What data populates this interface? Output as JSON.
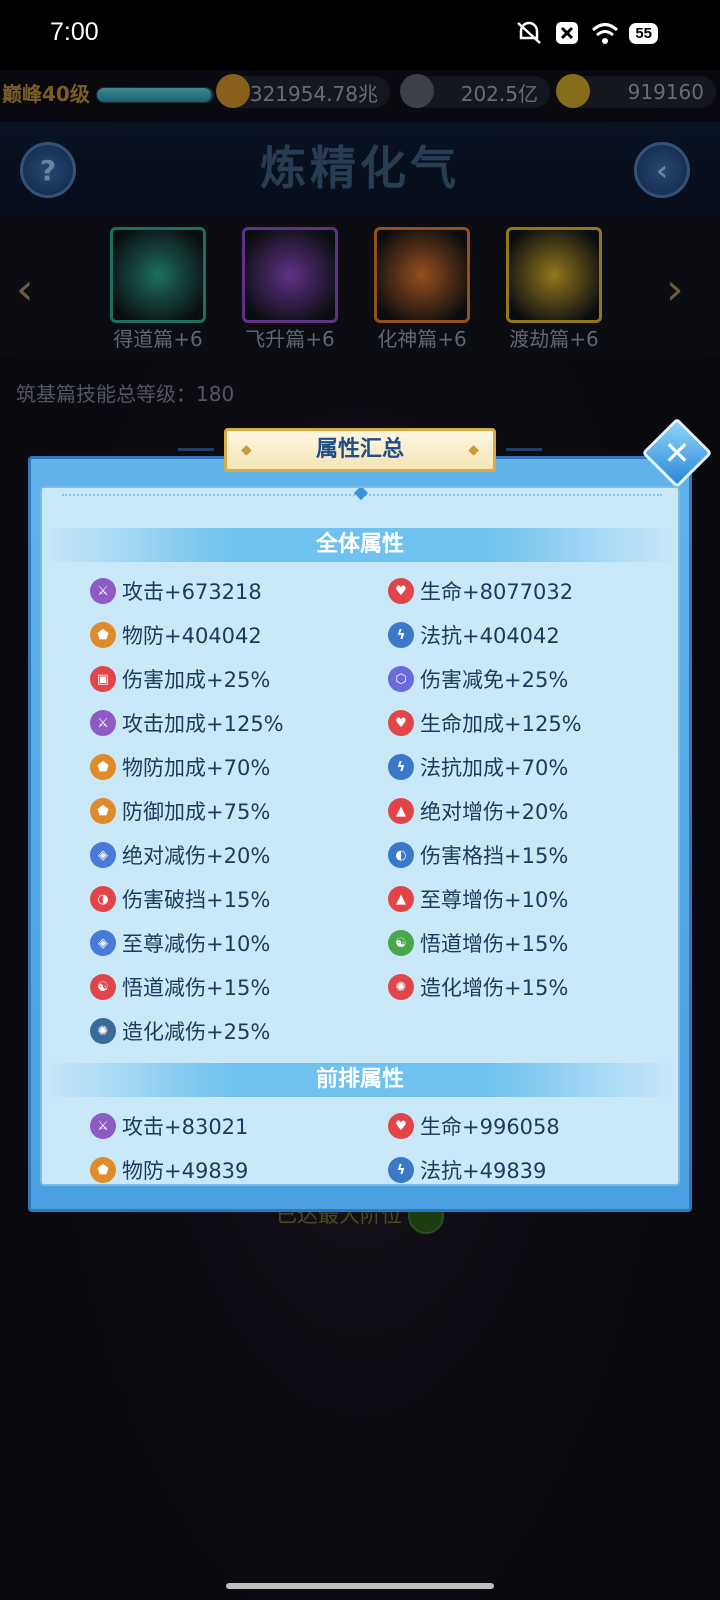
{
  "status_bar": {
    "time": "7:00",
    "battery": "55",
    "icons": [
      "mute-icon",
      "close-notification-icon",
      "wifi-icon",
      "battery-icon"
    ]
  },
  "top_bar": {
    "level": "巅峰40级",
    "exp_fraction": 0.98,
    "combat_power": "321954.78兆",
    "coins": "202.5亿",
    "gold": "919160"
  },
  "title": "炼精化气",
  "chapters": [
    {
      "label": "得道篇+6",
      "color": "#2aa38c"
    },
    {
      "label": "飞升篇+6",
      "color": "#8c4ac8"
    },
    {
      "label": "化神篇+6",
      "color": "#e0742a"
    },
    {
      "label": "渡劫篇+6",
      "color": "#d8b02a"
    }
  ],
  "skill_total": "筑基篇技能总等级：180",
  "bottom_text": "已达最大阶位",
  "modal": {
    "title": "属性汇总",
    "close": "✕",
    "sections": [
      {
        "heading": "全体属性",
        "items": [
          {
            "text": "攻击+673218",
            "icon": "attack-icon",
            "color": "#8e5ac4",
            "glyph": "⚔"
          },
          {
            "text": "生命+8077032",
            "icon": "heart-icon",
            "color": "#e0454a",
            "glyph": "♥"
          },
          {
            "text": "物防+404042",
            "icon": "shield-icon",
            "color": "#e08a2a",
            "glyph": "⬟"
          },
          {
            "text": "法抗+404042",
            "icon": "magic-resist-icon",
            "color": "#3a78c8",
            "glyph": "ϟ"
          },
          {
            "text": "伤害加成+25%",
            "icon": "damage-bonus-icon",
            "color": "#e0454a",
            "glyph": "▣"
          },
          {
            "text": "伤害减免+25%",
            "icon": "damage-reduction-icon",
            "color": "#6a6ad8",
            "glyph": "⬡"
          },
          {
            "text": "攻击加成+125%",
            "icon": "attack-bonus-icon",
            "color": "#8e5ac4",
            "glyph": "⚔"
          },
          {
            "text": "生命加成+125%",
            "icon": "life-bonus-icon",
            "color": "#e0454a",
            "glyph": "♥"
          },
          {
            "text": "物防加成+70%",
            "icon": "defense-bonus-icon",
            "color": "#e08a2a",
            "glyph": "⬟"
          },
          {
            "text": "法抗加成+70%",
            "icon": "resist-bonus-icon",
            "color": "#3a78c8",
            "glyph": "ϟ"
          },
          {
            "text": "防御加成+75%",
            "icon": "guard-bonus-icon",
            "color": "#e08a2a",
            "glyph": "⬟"
          },
          {
            "text": "绝对增伤+20%",
            "icon": "absolute-damage-icon",
            "color": "#e0454a",
            "glyph": "▲"
          },
          {
            "text": "绝对减伤+20%",
            "icon": "absolute-reduction-icon",
            "color": "#4a7ad8",
            "glyph": "◈"
          },
          {
            "text": "伤害格挡+15%",
            "icon": "damage-block-icon",
            "color": "#3a78c8",
            "glyph": "◐"
          },
          {
            "text": "伤害破挡+15%",
            "icon": "block-break-icon",
            "color": "#e0454a",
            "glyph": "◑"
          },
          {
            "text": "至尊增伤+10%",
            "icon": "supreme-damage-icon",
            "color": "#e0454a",
            "glyph": "▲"
          },
          {
            "text": "至尊减伤+10%",
            "icon": "supreme-reduction-icon",
            "color": "#4a7ad8",
            "glyph": "◈"
          },
          {
            "text": "悟道增伤+15%",
            "icon": "enlighten-damage-icon",
            "color": "#4aa84a",
            "glyph": "☯"
          },
          {
            "text": "悟道减伤+15%",
            "icon": "enlighten-reduction-icon",
            "color": "#e0454a",
            "glyph": "☯"
          },
          {
            "text": "造化增伤+15%",
            "icon": "creation-damage-icon",
            "color": "#e0454a",
            "glyph": "✺"
          },
          {
            "text": "造化减伤+25%",
            "icon": "creation-reduction-icon",
            "color": "#3a6a9a",
            "glyph": "✺"
          }
        ]
      },
      {
        "heading": "前排属性",
        "items": [
          {
            "text": "攻击+83021",
            "icon": "attack-icon",
            "color": "#8e5ac4",
            "glyph": "⚔"
          },
          {
            "text": "生命+996058",
            "icon": "heart-icon",
            "color": "#e0454a",
            "glyph": "♥"
          },
          {
            "text": "物防+49839",
            "icon": "shield-icon",
            "color": "#e08a2a",
            "glyph": "⬟"
          },
          {
            "text": "法抗+49839",
            "icon": "magic-resist-icon",
            "color": "#3a78c8",
            "glyph": "ϟ"
          }
        ]
      }
    ]
  }
}
